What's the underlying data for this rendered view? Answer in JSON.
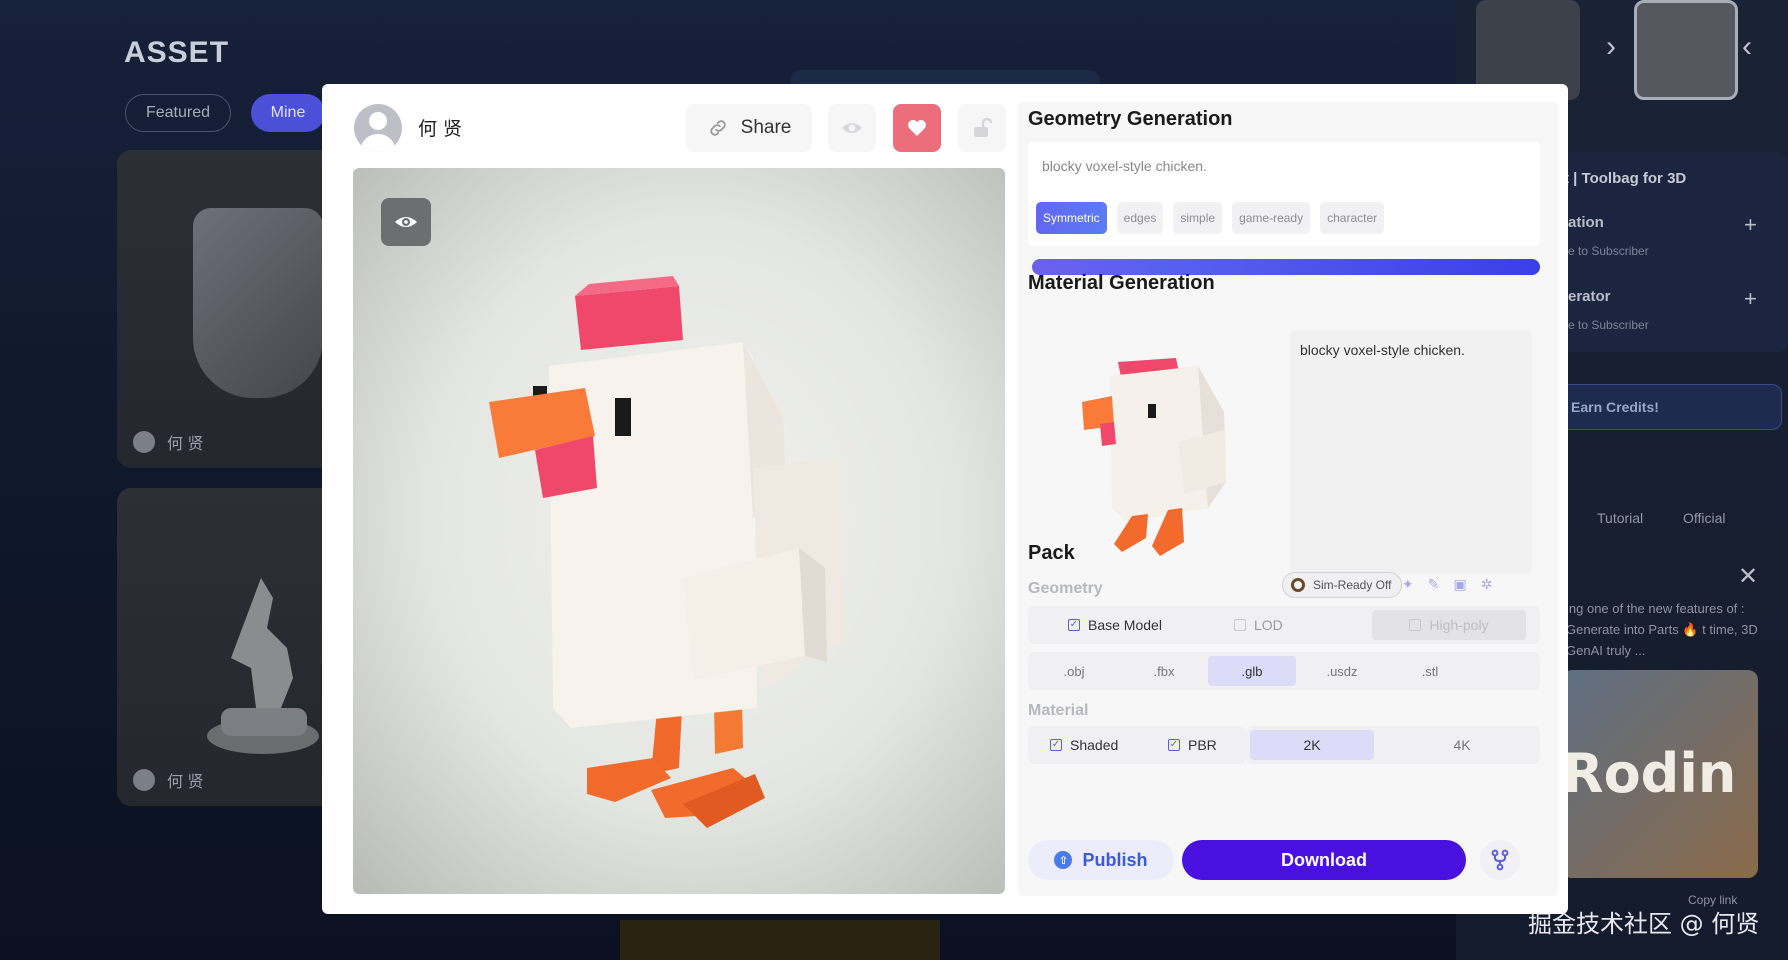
{
  "background": {
    "page_title": "ASSET",
    "tabs": [
      "Featured",
      "Mine"
    ],
    "cards": [
      {
        "user": "何 贤"
      },
      {
        "user": "何 贤"
      }
    ],
    "right_panel": {
      "heading": "t | Toolbag for 3D",
      "items": [
        {
          "title": "ation",
          "sub": "e to Subscriber"
        },
        {
          "title": "erator",
          "sub": "e to Subscriber"
        }
      ],
      "earn": "Earn Credits!",
      "links": [
        "Tutorial",
        "Official"
      ],
      "news": "ing one of the new features of : Generate into Parts 🔥 t time, 3D GenAI truly ...",
      "banner_text": "Rodin",
      "copy_link": "Copy link"
    },
    "watermark": "掘金技术社区 @ 何贤"
  },
  "modal": {
    "user_name": "何 贤",
    "share_label": "Share",
    "geometry": {
      "title": "Geometry Generation",
      "prompt": "blocky voxel-style chicken.",
      "tags": [
        "Symmetric",
        "edges",
        "simple",
        "game-ready",
        "character"
      ],
      "progress": 1.0
    },
    "material": {
      "title": "Material Generation",
      "prompt": "blocky voxel-style chicken."
    },
    "pack": {
      "title": "Pack",
      "geometry_label": "Geometry",
      "sim_ready": "Sim-Ready Off",
      "options": {
        "base_model": "Base Model",
        "lod": "LOD",
        "high_poly": "High-poly"
      },
      "formats": [
        ".obj",
        ".fbx",
        ".glb",
        ".usdz",
        ".stl"
      ],
      "selected_format": ".glb",
      "material_label": "Material",
      "material_options": {
        "shaded": "Shaded",
        "pbr": "PBR"
      },
      "resolutions": [
        "2K",
        "4K"
      ],
      "selected_resolution": "2K"
    },
    "actions": {
      "publish": "Publish",
      "download": "Download"
    },
    "colors": {
      "accent": "#4a10e0",
      "heart": "#ec6e7d",
      "chicken_comb": "#f0486a",
      "chicken_beak": "#fa7a3a"
    }
  }
}
